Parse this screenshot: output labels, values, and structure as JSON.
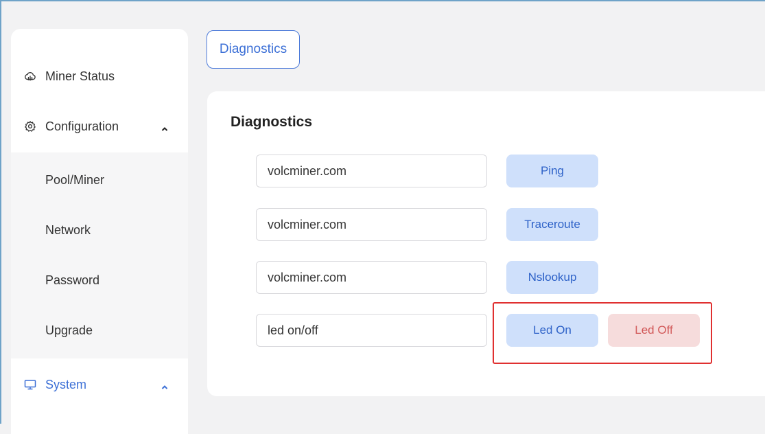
{
  "sidebar": {
    "items": [
      {
        "label": "Miner Status",
        "icon": "cloud-icon"
      },
      {
        "label": "Configuration",
        "icon": "gear-icon",
        "expanded": true
      },
      {
        "label": "System",
        "icon": "monitor-icon",
        "expanded": true
      }
    ],
    "sub_items": [
      "Pool/Miner",
      "Network",
      "Password",
      "Upgrade"
    ]
  },
  "tab": {
    "label": "Diagnostics"
  },
  "panel": {
    "title": "Diagnostics",
    "rows": [
      {
        "input_value": "volcminer.com",
        "button": "Ping"
      },
      {
        "input_value": "volcminer.com",
        "button": "Traceroute"
      },
      {
        "input_value": "volcminer.com",
        "button": "Nslookup"
      },
      {
        "input_value": "led on/off",
        "button": "Led On",
        "button2": "Led Off"
      }
    ]
  },
  "colors": {
    "accent": "#3b6fd6",
    "button_blue_bg": "#cfe0fb",
    "button_red_bg": "#f6dcdc",
    "highlight_box": "#e03030"
  }
}
